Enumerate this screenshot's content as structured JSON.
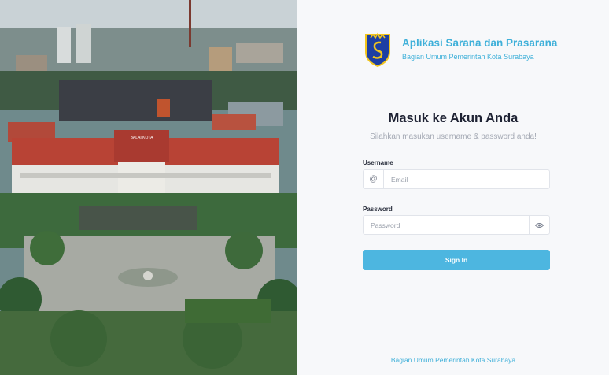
{
  "app": {
    "title": "Aplikasi Sarana dan Prasarana",
    "subtitle": "Bagian Umum Pemerintah Kota Surabaya"
  },
  "login": {
    "heading": "Masuk ke Akun Anda",
    "subheading": "Silahkan masukan username & password anda!",
    "username_label": "Username",
    "username_placeholder": "Email",
    "username_prefix": "@",
    "password_label": "Password",
    "password_placeholder": "Password",
    "password_toggle_icon": "eye-icon",
    "submit_label": "Sign In"
  },
  "photo": {
    "building_sign": "BALAI KOTA"
  },
  "footer": {
    "text": "Bagian Umum Pemerintah Kota Surabaya"
  },
  "colors": {
    "accent": "#4db6e0",
    "brand_text": "#3fb0d9",
    "heading": "#1e2233"
  }
}
